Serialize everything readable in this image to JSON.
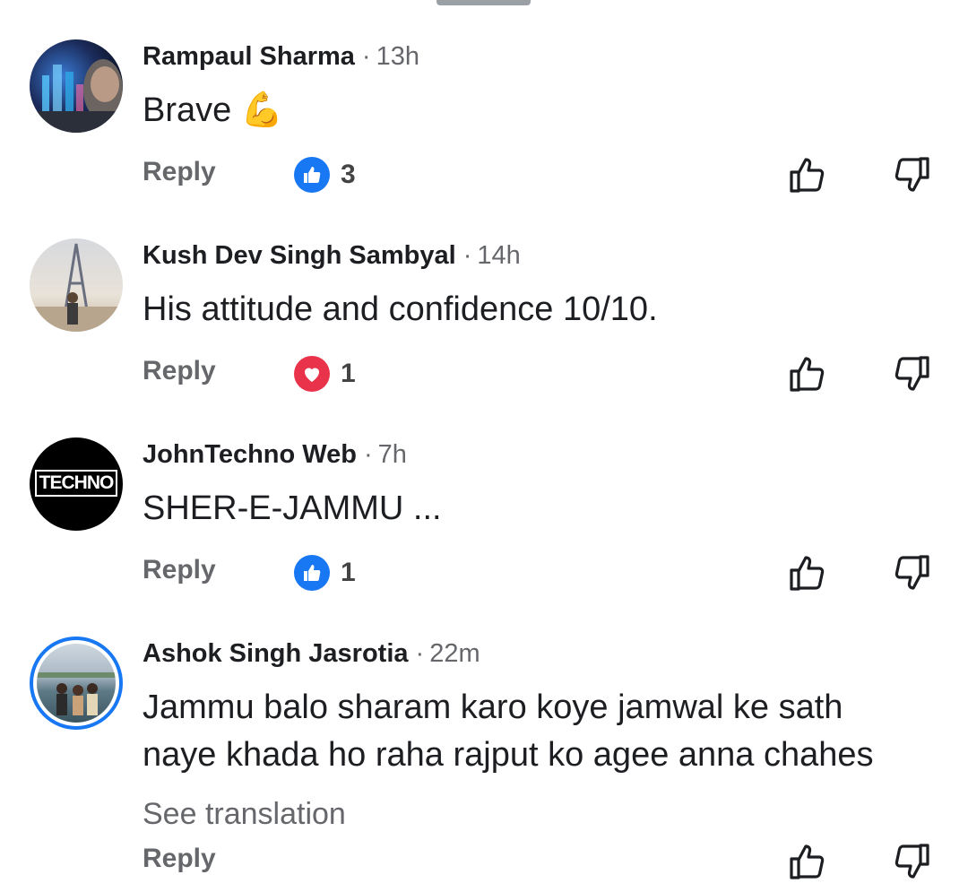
{
  "comments": [
    {
      "author": "Rampaul Sharma",
      "time": "13h",
      "text": "Brave",
      "emoji": "💪",
      "reply_label": "Reply",
      "reaction": {
        "type": "like",
        "count": "3",
        "color": "#1877f2"
      }
    },
    {
      "author": "Kush Dev Singh Sambyal",
      "time": "14h",
      "text": "His attitude and confidence 10/10.",
      "reply_label": "Reply",
      "reaction": {
        "type": "love",
        "count": "1",
        "color": "#e8334a"
      }
    },
    {
      "author": "JohnTechno Web",
      "time": "7h",
      "text": "SHER-E-JAMMU ...",
      "avatar_text": "TECHNO",
      "reply_label": "Reply",
      "reaction": {
        "type": "like",
        "count": "1",
        "color": "#1877f2"
      }
    },
    {
      "author": "Ashok Singh Jasrotia",
      "time": "22m",
      "text_line1": "Jammu balo sharam karo koye jamwal ke sath",
      "text_line2": "naye khada ho raha rajput ko agee anna chahes",
      "see_translation": "See translation",
      "reply_label": "Reply"
    }
  ],
  "separator": "·"
}
